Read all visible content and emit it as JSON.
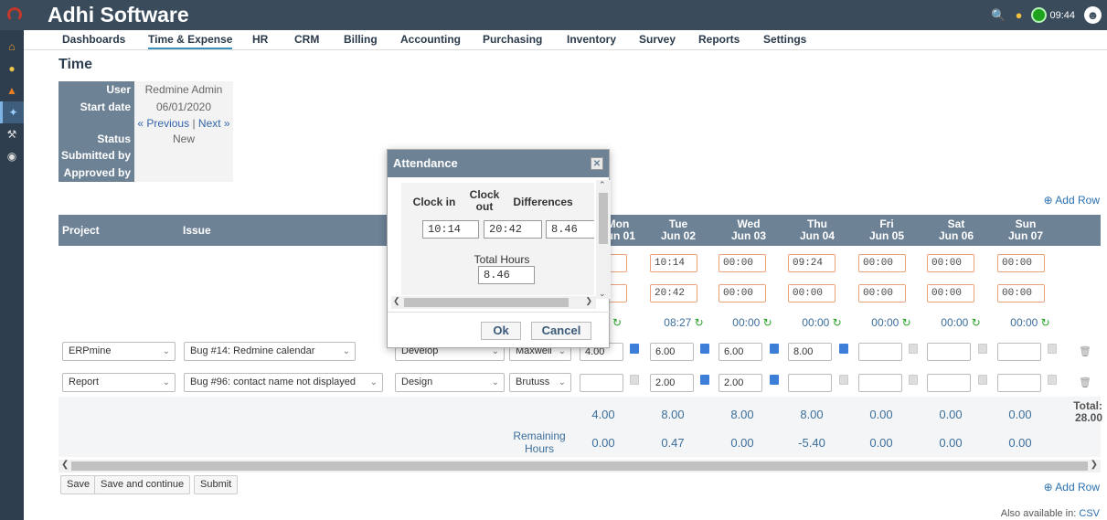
{
  "app": {
    "title": "Adhi Software",
    "clock": "09:44"
  },
  "menu": [
    "Dashboards",
    "Time & Expense",
    "HR",
    "CRM",
    "Billing",
    "Accounting",
    "Purchasing",
    "Inventory",
    "Survey",
    "Reports",
    "Settings"
  ],
  "page_title": "Time",
  "info": {
    "user_label": "User",
    "user_value": "Redmine Admin",
    "start_label": "Start date",
    "start_value": "06/01/2020",
    "prev": "« Previous",
    "sep": " | ",
    "next": "Next »",
    "status_label": "Status",
    "status_value": "New",
    "submitted_label": "Submitted by",
    "approved_label": "Approved by"
  },
  "add_row": "Add Row",
  "table": {
    "project_header": "Project",
    "issue_header": "Issue",
    "days": [
      {
        "day": "Mon",
        "date": "Jun 01"
      },
      {
        "day": "Tue",
        "date": "Jun 02"
      },
      {
        "day": "Wed",
        "date": "Jun 03"
      },
      {
        "day": "Thu",
        "date": "Jun 04"
      },
      {
        "day": "Fri",
        "date": "Jun 05"
      },
      {
        "day": "Sat",
        "date": "Jun 06"
      },
      {
        "day": "Sun",
        "date": "Jun 07"
      }
    ],
    "clock_in": [
      "",
      "10:14",
      "00:00",
      "09:24",
      "00:00",
      "00:00",
      "00:00"
    ],
    "clock_out": [
      "",
      "20:42",
      "00:00",
      "00:00",
      "00:00",
      "00:00",
      "00:00"
    ],
    "diffs": [
      "0",
      "08:27",
      "00:00",
      "00:00",
      "00:00",
      "00:00",
      "00:00"
    ],
    "rows": [
      {
        "project": "ERPmine",
        "issue": "Bug #14: Redmine calendar",
        "activity": "Develop",
        "user": "Maxwell",
        "hours": [
          "4.00",
          "6.00",
          "6.00",
          "8.00",
          "",
          "",
          ""
        ],
        "comments": [
          true,
          true,
          true,
          true,
          false,
          false,
          false
        ]
      },
      {
        "project": "Report",
        "issue": "Bug #96: contact name not displayed",
        "activity": "Design",
        "user": "Brutuss",
        "hours": [
          "",
          "2.00",
          "2.00",
          "",
          "",
          "",
          ""
        ],
        "comments": [
          false,
          true,
          true,
          false,
          false,
          false,
          false
        ]
      }
    ],
    "totals": [
      "4.00",
      "8.00",
      "8.00",
      "8.00",
      "0.00",
      "0.00",
      "0.00"
    ],
    "total_label": "Total:",
    "grand_total": "28.00",
    "remaining_label": "Remaining Hours",
    "remaining": [
      "0.00",
      "0.47",
      "0.00",
      "-5.40",
      "0.00",
      "0.00",
      "0.00"
    ]
  },
  "buttons": {
    "save": "Save",
    "save_continue": "Save and continue",
    "submit": "Submit"
  },
  "available": {
    "label": "Also available in:",
    "csv": "CSV"
  },
  "dialog": {
    "title": "Attendance",
    "clock_in_label": "Clock in",
    "clock_out_label": "Clock out",
    "diff_label": "Differences",
    "clock_in_value": "10:14",
    "clock_out_value": "20:42",
    "diff_value": "8.46",
    "total_label": "Total Hours",
    "total_value": "8.46",
    "ok": "Ok",
    "cancel": "Cancel"
  }
}
